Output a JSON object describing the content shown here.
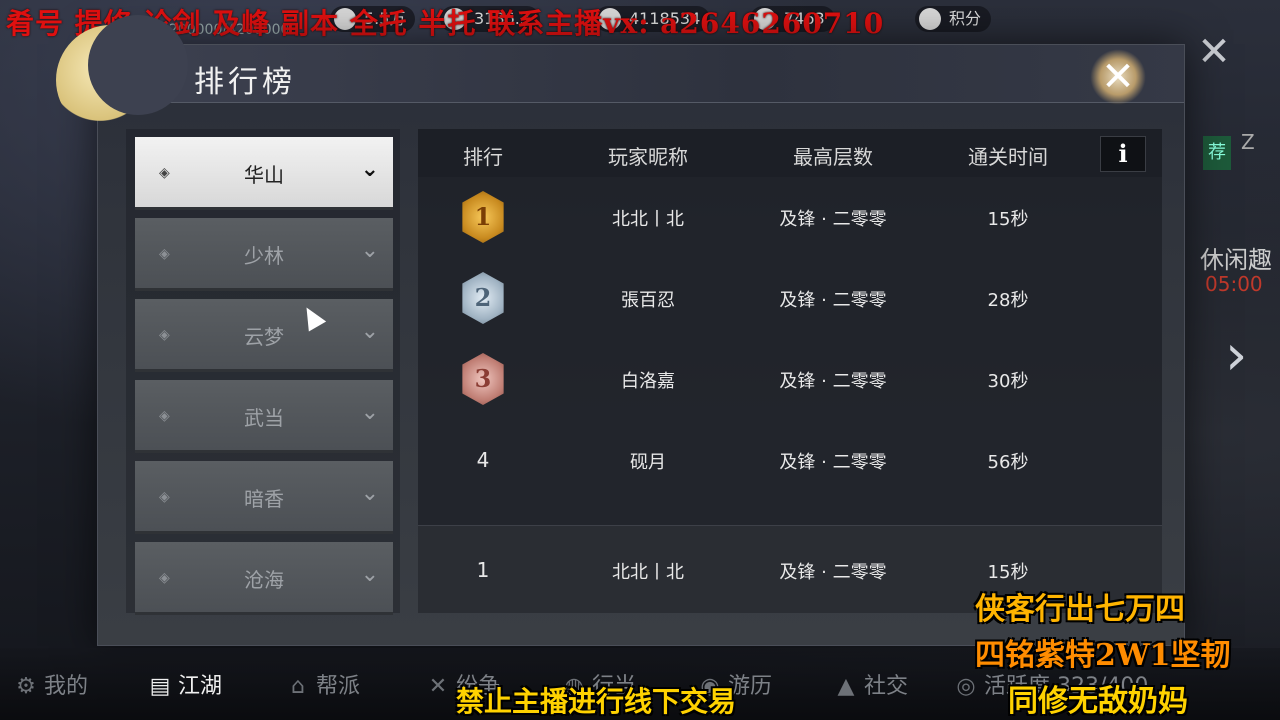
{
  "top_bar": {
    "watermark": "肴号 提修 论剑 及峰 副本 全托 半托 联系主播vx: a2646260710",
    "xp": "4200000/4200000",
    "chips": [
      {
        "icon": "coin-icon",
        "value": "5.5万"
      },
      {
        "icon": "silver-icon",
        "value": "3186.3"
      },
      {
        "icon": "gem-icon",
        "value": "4118534"
      },
      {
        "icon": "rice-icon",
        "value": "7463"
      },
      {
        "icon": "points-icon",
        "value": "积分"
      }
    ]
  },
  "dialog": {
    "title": "排行榜",
    "close_label": "✕"
  },
  "menu": {
    "items": [
      {
        "label": "华山",
        "active": true
      },
      {
        "label": "少林",
        "active": false
      },
      {
        "label": "云梦",
        "active": false
      },
      {
        "label": "武当",
        "active": false
      },
      {
        "label": "暗香",
        "active": false
      },
      {
        "label": "沧海",
        "active": false
      }
    ]
  },
  "table": {
    "headers": [
      "排行",
      "玩家昵称",
      "最高层数",
      "通关时间"
    ],
    "info_label": "i",
    "rows": [
      {
        "rank": "1",
        "medal": "gold",
        "name": "北北丨北",
        "floor": "及锋 · 二零零",
        "time": "15秒"
      },
      {
        "rank": "2",
        "medal": "silver",
        "name": "張百忍",
        "floor": "及锋 · 二零零",
        "time": "28秒"
      },
      {
        "rank": "3",
        "medal": "bronze",
        "name": "白洛嘉",
        "floor": "及锋 · 二零零",
        "time": "30秒"
      },
      {
        "rank": "4",
        "medal": "",
        "name": "砚月",
        "floor": "及锋 · 二零零",
        "time": "56秒"
      }
    ],
    "my_row": {
      "rank": "1",
      "name": "北北丨北",
      "floor": "及锋 · 二零零",
      "time": "15秒"
    }
  },
  "side": {
    "badge": "荐",
    "z": "Z",
    "leisure": "休闲趣",
    "timer": "05:00"
  },
  "bottom_nav": {
    "items": [
      {
        "icon": "gear-icon",
        "label": "我的"
      },
      {
        "icon": "map-icon",
        "label": "江湖"
      },
      {
        "icon": "guild-icon",
        "label": "帮派"
      },
      {
        "icon": "swords-icon",
        "label": "纷争"
      },
      {
        "icon": "travel-icon",
        "label": "行当"
      },
      {
        "icon": "journey-icon",
        "label": "游历"
      },
      {
        "icon": "social-icon",
        "label": "社交"
      },
      {
        "icon": "activity-icon",
        "label": "活跃度 323/400"
      }
    ]
  },
  "overlays": {
    "bottom_notice": "禁止主播进行线下交易",
    "right_lines": [
      "侠客行出七万四",
      "四铭紫特2W1坚韧",
      "同修无敌奶妈"
    ]
  }
}
